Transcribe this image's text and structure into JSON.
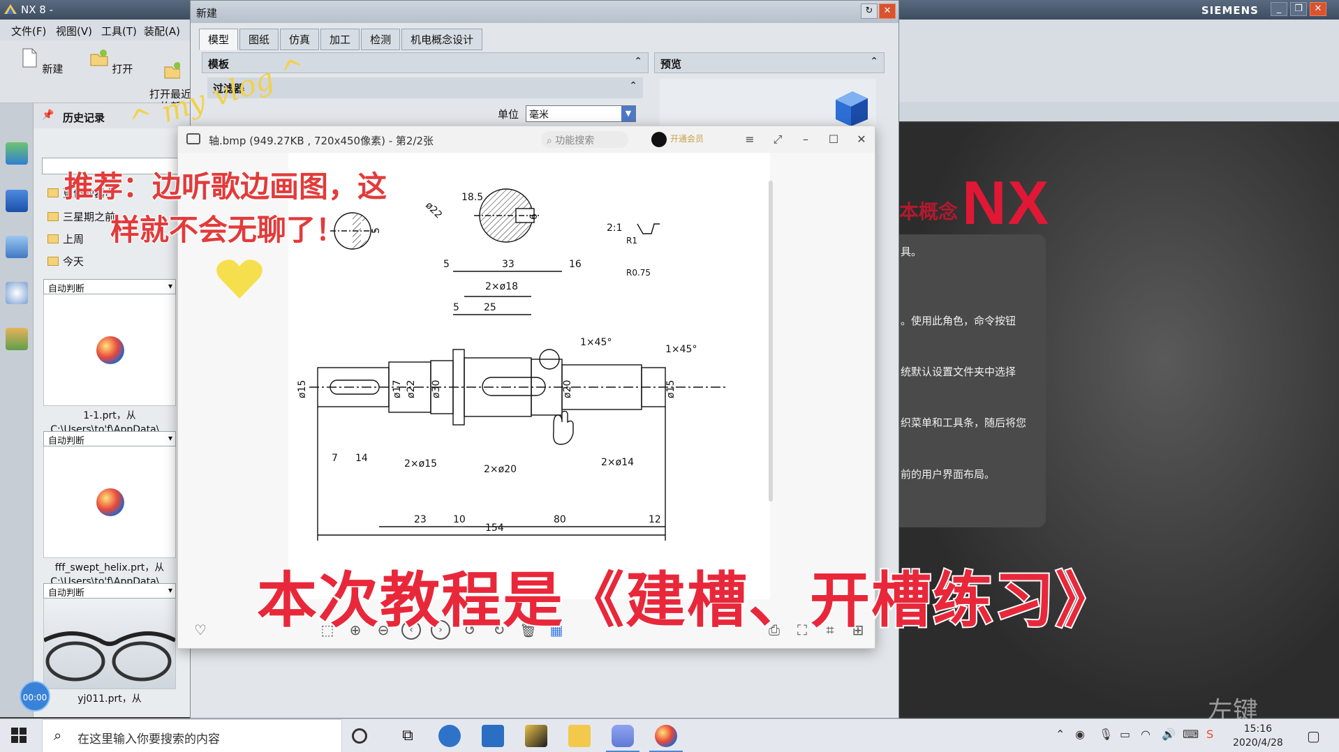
{
  "nx": {
    "title": "NX 8 -",
    "brand": "SIEMENS",
    "menu": [
      "文件(F)",
      "视图(V)",
      "工具(T)",
      "装配(A)"
    ],
    "ribbon": [
      {
        "label": "新建",
        "icon": "new-file-icon"
      },
      {
        "label": "打开",
        "icon": "open-folder-icon"
      },
      {
        "label": "打开最近\n的部",
        "icon": "open-recent-icon"
      }
    ],
    "history": {
      "title": "历史记录",
      "folders": [
        "更值的器白",
        "三星期之前",
        "上周",
        "今天"
      ],
      "cards": [
        {
          "dropdown": "自动判断",
          "caption1": "1-1.prt，从",
          "caption2": "C:\\Users\\to'f\\AppData\\..."
        },
        {
          "dropdown": "自动判断",
          "caption1": "fff_swept_helix.prt，从",
          "caption2": "C:\\Users\\to'f\\AppData\\..."
        },
        {
          "dropdown": "自动判断",
          "caption1": "yj011.prt，从",
          "caption2": ""
        }
      ]
    },
    "home": {
      "logo": "NX",
      "concept": "本概念",
      "lines": [
        "具。",
        "。使用此角色，命令按钮",
        "统默认设置文件夹中选择",
        "织菜单和工具条，随后将您",
        "前的用户界面布局。"
      ]
    }
  },
  "dialog": {
    "title": "新建",
    "tabs": [
      "模型",
      "图纸",
      "仿真",
      "加工",
      "检测",
      "机电概念设计"
    ],
    "active_tab": "模型",
    "template_label": "模板",
    "filter_label": "过滤器",
    "units_label": "单位",
    "units_value": "毫米",
    "preview_label": "预览"
  },
  "viewer": {
    "title": "轴.bmp (949.27KB , 720x450像素) - 第2/2张",
    "search_placeholder": "功能搜索",
    "vip": "开通会员"
  },
  "drawing": {
    "dims": {
      "d185": "18.5",
      "d22": "ø22",
      "d6": "6",
      "d5": "5",
      "scale": "2:1",
      "r1": "R1",
      "r075": "R0.75",
      "t5": "5",
      "t33": "33",
      "t16": "16",
      "h2x18": "2×ø18",
      "t5b": "5",
      "t25": "25",
      "c1": "1×45°",
      "c2": "1×45°",
      "l15": "ø15",
      "l17": "ø17",
      "l22": "ø22",
      "l30": "ø30",
      "l20": "ø20",
      "r15": "ø15",
      "b7": "7",
      "b14": "14",
      "b2x15": "2×ø15",
      "b2x20": "2×ø20",
      "b2x14": "2×ø14",
      "b23": "23",
      "b10": "10",
      "b80": "80",
      "b12": "12",
      "b154": "154"
    }
  },
  "overlay": {
    "vlog": "^ my vlog ^",
    "rec1": "推荐：边听歌边画图，这",
    "rec2": "样就不会无聊了！",
    "banner": "本次教程是《建槽、开槽练习》",
    "timer": "00:00",
    "left_key": "左键"
  },
  "taskbar": {
    "search": "在这里输入你要搜索的内容",
    "time": "15:16",
    "date": "2020/4/28"
  }
}
